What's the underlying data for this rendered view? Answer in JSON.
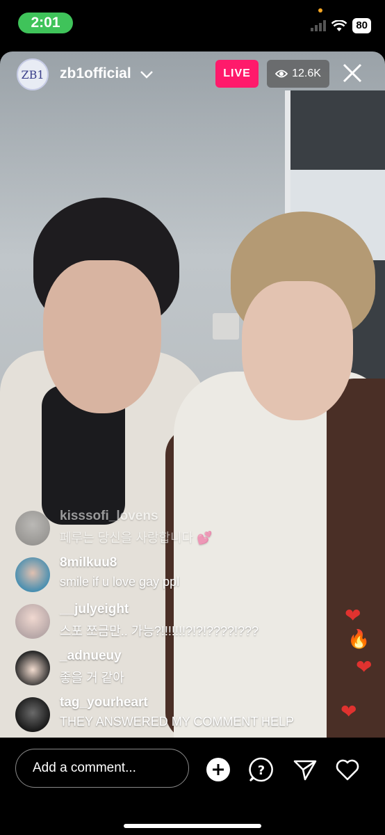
{
  "status_bar": {
    "time": "2:01",
    "battery": "80"
  },
  "header": {
    "avatar_text": "ZB1",
    "account_name": "zb1official",
    "live_label": "LIVE",
    "viewer_count": "12.6K"
  },
  "comments": [
    {
      "user": "kisssofi_lovens",
      "text": "페루는 당신을 사랑합니다 💕",
      "faded": true
    },
    {
      "user": "8milkuu8",
      "text": "smile if u love gay ppl"
    },
    {
      "user": "__julyeight",
      "text": "스포 쪼금만.. 가능?!!!!!!!?!?!????!???"
    },
    {
      "user": "_adnueuy",
      "text": "좋을 거 같아"
    },
    {
      "user": "tag_yourheart",
      "text": "THEY ANSWERED MY COMMENT HELP"
    }
  ],
  "reactions": [
    "❤",
    "🔥",
    "❤",
    "❤"
  ],
  "bottom_bar": {
    "comment_placeholder": "Add a comment..."
  },
  "colors": {
    "live": "#ff1a6b",
    "status_time_pill": "#3fc35a",
    "heart": "#e0322f"
  }
}
